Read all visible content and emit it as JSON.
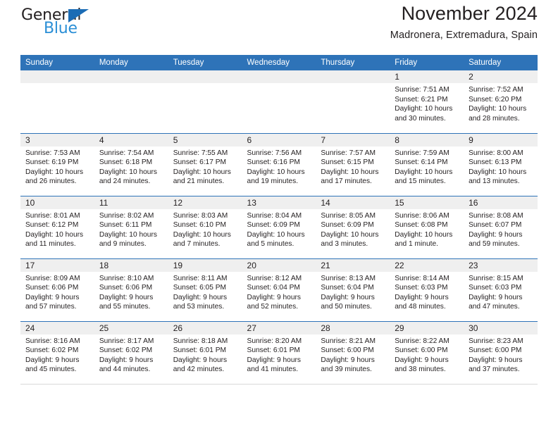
{
  "brand": {
    "name_part1": "General",
    "name_part2": "Blue",
    "accent_color": "#2b8fd6",
    "triangle_color": "#1b6cb5"
  },
  "header": {
    "title": "November 2024",
    "subtitle": "Madronera, Extremadura, Spain",
    "header_bg": "#2e73b8"
  },
  "calendar": {
    "weekday_headers": [
      "Sunday",
      "Monday",
      "Tuesday",
      "Wednesday",
      "Thursday",
      "Friday",
      "Saturday"
    ],
    "weeks": [
      [
        {
          "day": "",
          "empty": true
        },
        {
          "day": "",
          "empty": true
        },
        {
          "day": "",
          "empty": true
        },
        {
          "day": "",
          "empty": true
        },
        {
          "day": "",
          "empty": true
        },
        {
          "day": "1",
          "sunrise": "Sunrise: 7:51 AM",
          "sunset": "Sunset: 6:21 PM",
          "daylight": "Daylight: 10 hours and 30 minutes."
        },
        {
          "day": "2",
          "sunrise": "Sunrise: 7:52 AM",
          "sunset": "Sunset: 6:20 PM",
          "daylight": "Daylight: 10 hours and 28 minutes."
        }
      ],
      [
        {
          "day": "3",
          "sunrise": "Sunrise: 7:53 AM",
          "sunset": "Sunset: 6:19 PM",
          "daylight": "Daylight: 10 hours and 26 minutes."
        },
        {
          "day": "4",
          "sunrise": "Sunrise: 7:54 AM",
          "sunset": "Sunset: 6:18 PM",
          "daylight": "Daylight: 10 hours and 24 minutes."
        },
        {
          "day": "5",
          "sunrise": "Sunrise: 7:55 AM",
          "sunset": "Sunset: 6:17 PM",
          "daylight": "Daylight: 10 hours and 21 minutes."
        },
        {
          "day": "6",
          "sunrise": "Sunrise: 7:56 AM",
          "sunset": "Sunset: 6:16 PM",
          "daylight": "Daylight: 10 hours and 19 minutes."
        },
        {
          "day": "7",
          "sunrise": "Sunrise: 7:57 AM",
          "sunset": "Sunset: 6:15 PM",
          "daylight": "Daylight: 10 hours and 17 minutes."
        },
        {
          "day": "8",
          "sunrise": "Sunrise: 7:59 AM",
          "sunset": "Sunset: 6:14 PM",
          "daylight": "Daylight: 10 hours and 15 minutes."
        },
        {
          "day": "9",
          "sunrise": "Sunrise: 8:00 AM",
          "sunset": "Sunset: 6:13 PM",
          "daylight": "Daylight: 10 hours and 13 minutes."
        }
      ],
      [
        {
          "day": "10",
          "sunrise": "Sunrise: 8:01 AM",
          "sunset": "Sunset: 6:12 PM",
          "daylight": "Daylight: 10 hours and 11 minutes."
        },
        {
          "day": "11",
          "sunrise": "Sunrise: 8:02 AM",
          "sunset": "Sunset: 6:11 PM",
          "daylight": "Daylight: 10 hours and 9 minutes."
        },
        {
          "day": "12",
          "sunrise": "Sunrise: 8:03 AM",
          "sunset": "Sunset: 6:10 PM",
          "daylight": "Daylight: 10 hours and 7 minutes."
        },
        {
          "day": "13",
          "sunrise": "Sunrise: 8:04 AM",
          "sunset": "Sunset: 6:09 PM",
          "daylight": "Daylight: 10 hours and 5 minutes."
        },
        {
          "day": "14",
          "sunrise": "Sunrise: 8:05 AM",
          "sunset": "Sunset: 6:09 PM",
          "daylight": "Daylight: 10 hours and 3 minutes."
        },
        {
          "day": "15",
          "sunrise": "Sunrise: 8:06 AM",
          "sunset": "Sunset: 6:08 PM",
          "daylight": "Daylight: 10 hours and 1 minute."
        },
        {
          "day": "16",
          "sunrise": "Sunrise: 8:08 AM",
          "sunset": "Sunset: 6:07 PM",
          "daylight": "Daylight: 9 hours and 59 minutes."
        }
      ],
      [
        {
          "day": "17",
          "sunrise": "Sunrise: 8:09 AM",
          "sunset": "Sunset: 6:06 PM",
          "daylight": "Daylight: 9 hours and 57 minutes."
        },
        {
          "day": "18",
          "sunrise": "Sunrise: 8:10 AM",
          "sunset": "Sunset: 6:06 PM",
          "daylight": "Daylight: 9 hours and 55 minutes."
        },
        {
          "day": "19",
          "sunrise": "Sunrise: 8:11 AM",
          "sunset": "Sunset: 6:05 PM",
          "daylight": "Daylight: 9 hours and 53 minutes."
        },
        {
          "day": "20",
          "sunrise": "Sunrise: 8:12 AM",
          "sunset": "Sunset: 6:04 PM",
          "daylight": "Daylight: 9 hours and 52 minutes."
        },
        {
          "day": "21",
          "sunrise": "Sunrise: 8:13 AM",
          "sunset": "Sunset: 6:04 PM",
          "daylight": "Daylight: 9 hours and 50 minutes."
        },
        {
          "day": "22",
          "sunrise": "Sunrise: 8:14 AM",
          "sunset": "Sunset: 6:03 PM",
          "daylight": "Daylight: 9 hours and 48 minutes."
        },
        {
          "day": "23",
          "sunrise": "Sunrise: 8:15 AM",
          "sunset": "Sunset: 6:03 PM",
          "daylight": "Daylight: 9 hours and 47 minutes."
        }
      ],
      [
        {
          "day": "24",
          "sunrise": "Sunrise: 8:16 AM",
          "sunset": "Sunset: 6:02 PM",
          "daylight": "Daylight: 9 hours and 45 minutes."
        },
        {
          "day": "25",
          "sunrise": "Sunrise: 8:17 AM",
          "sunset": "Sunset: 6:02 PM",
          "daylight": "Daylight: 9 hours and 44 minutes."
        },
        {
          "day": "26",
          "sunrise": "Sunrise: 8:18 AM",
          "sunset": "Sunset: 6:01 PM",
          "daylight": "Daylight: 9 hours and 42 minutes."
        },
        {
          "day": "27",
          "sunrise": "Sunrise: 8:20 AM",
          "sunset": "Sunset: 6:01 PM",
          "daylight": "Daylight: 9 hours and 41 minutes."
        },
        {
          "day": "28",
          "sunrise": "Sunrise: 8:21 AM",
          "sunset": "Sunset: 6:00 PM",
          "daylight": "Daylight: 9 hours and 39 minutes."
        },
        {
          "day": "29",
          "sunrise": "Sunrise: 8:22 AM",
          "sunset": "Sunset: 6:00 PM",
          "daylight": "Daylight: 9 hours and 38 minutes."
        },
        {
          "day": "30",
          "sunrise": "Sunrise: 8:23 AM",
          "sunset": "Sunset: 6:00 PM",
          "daylight": "Daylight: 9 hours and 37 minutes."
        }
      ]
    ]
  }
}
